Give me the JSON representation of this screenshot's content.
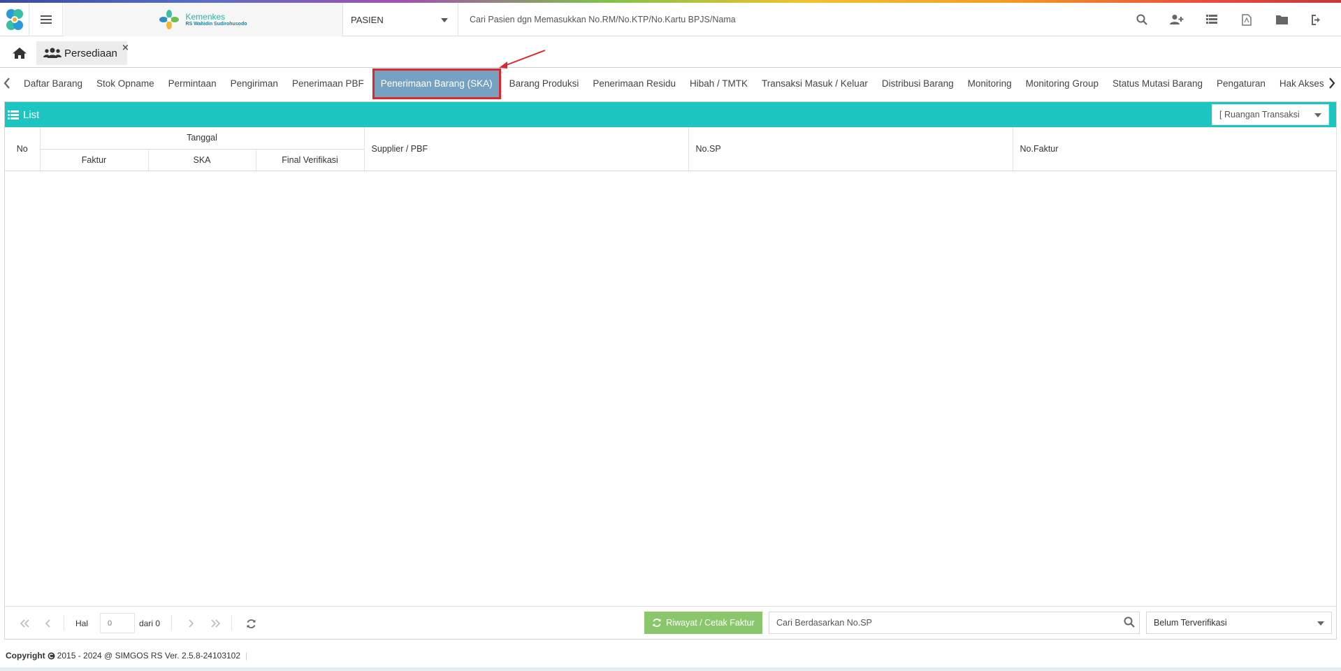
{
  "header": {
    "brand_name": "Kemenkes",
    "brand_sub": "RS Wahidin Sudirohusodo",
    "patient_select": "PASIEN",
    "search_placeholder": "Cari Pasien dgn Memasukkan No.RM/No.KTP/No.Kartu BPJS/Nama",
    "icons": [
      "search-icon",
      "add-user-icon",
      "list-icon",
      "pdf-icon",
      "folder-icon",
      "logout-icon"
    ]
  },
  "page_tabs": {
    "active_label": "Persediaan",
    "close_glyph": "×"
  },
  "subnav": {
    "items": [
      "Daftar Barang",
      "Stok Opname",
      "Permintaan",
      "Pengiriman",
      "Penerimaan PBF",
      "Penerimaan Barang (SKA)",
      "Barang Produksi",
      "Penerimaan Residu",
      "Hibah / TMTK",
      "Transaksi Masuk / Keluar",
      "Distribusi Barang",
      "Monitoring",
      "Monitoring Group",
      "Status Mutasi Barang",
      "Pengaturan",
      "Hak Akses"
    ],
    "active_index": 5
  },
  "panel": {
    "title": "List",
    "ruangan_select": "[ Ruangan Transaksi",
    "columns": {
      "no": "No",
      "tanggal": "Tanggal",
      "faktur": "Faktur",
      "ska": "SKA",
      "final_verifikasi": "Final Verifikasi",
      "supplier": "Supplier / PBF",
      "no_sp": "No.SP",
      "no_faktur": "No.Faktur"
    },
    "rows": []
  },
  "pager": {
    "hal_label": "Hal",
    "page_value": "0",
    "of_label": "dari 0",
    "riwayat_label": "Riwayat / Cetak Faktur",
    "search_placeholder": "Cari Berdasarkan No.SP",
    "status_select": "Belum Terverifikasi"
  },
  "footer": {
    "copyright_label": "Copyright",
    "copyright_text": "2015 - 2024 @ SIMGOS RS Ver. 2.5.8-24103102"
  },
  "colors": {
    "panel_header": "#1dc5c0",
    "active_tab": "#76a2c2",
    "highlight_border": "#e1252c",
    "riwayat_button": "#8ac76c"
  }
}
